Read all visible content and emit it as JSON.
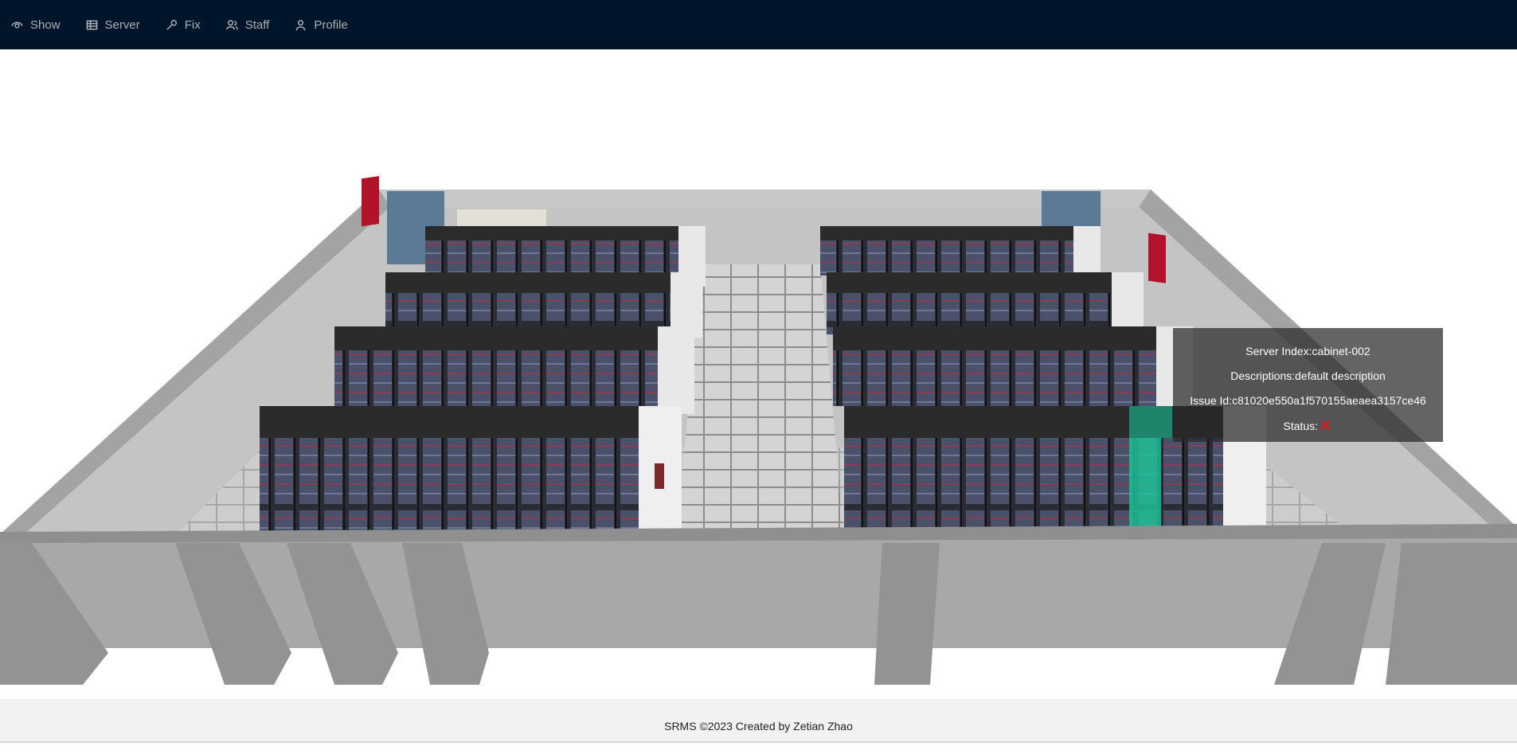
{
  "nav": {
    "items": [
      {
        "label": "Show",
        "icon": "eye-icon"
      },
      {
        "label": "Server",
        "icon": "table-icon"
      },
      {
        "label": "Fix",
        "icon": "wrench-icon"
      },
      {
        "label": "Staff",
        "icon": "team-icon"
      },
      {
        "label": "Profile",
        "icon": "user-icon"
      }
    ]
  },
  "tooltip": {
    "server_index": "Server Index:cabinet-002",
    "descriptions": "Descriptions:default description",
    "issue_id": "Issue Id:c81020e550a1f570155aeaea3157ce46",
    "status_label": "Status:",
    "status_mark": "✕"
  },
  "footer": {
    "text": "SRMS ©2023 Created by Zetian Zhao"
  },
  "colors": {
    "nav_bg": "#001529",
    "highlight_cabinet": "#1fbf96",
    "status_error": "#e11111"
  }
}
